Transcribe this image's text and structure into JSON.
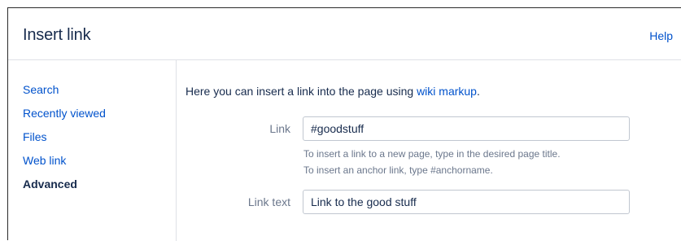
{
  "dialog": {
    "title": "Insert link",
    "help_label": "Help"
  },
  "sidebar": {
    "items": [
      {
        "label": "Search",
        "active": false
      },
      {
        "label": "Recently viewed",
        "active": false
      },
      {
        "label": "Files",
        "active": false
      },
      {
        "label": "Web link",
        "active": false
      },
      {
        "label": "Advanced",
        "active": true
      }
    ]
  },
  "main": {
    "intro_prefix": "Here you can insert a link into the page using ",
    "intro_link": "wiki markup",
    "intro_suffix": ".",
    "link_field": {
      "label": "Link",
      "value": "#goodstuff"
    },
    "hints": [
      "To insert a link to a new page, type in the desired page title.",
      "To insert an anchor link, type #anchorname."
    ],
    "link_text_field": {
      "label": "Link text",
      "value": "Link to the good stuff"
    }
  },
  "colors": {
    "link": "#0052cc",
    "text": "#172b4d",
    "muted": "#6b778c",
    "border": "#dfe1e6"
  }
}
